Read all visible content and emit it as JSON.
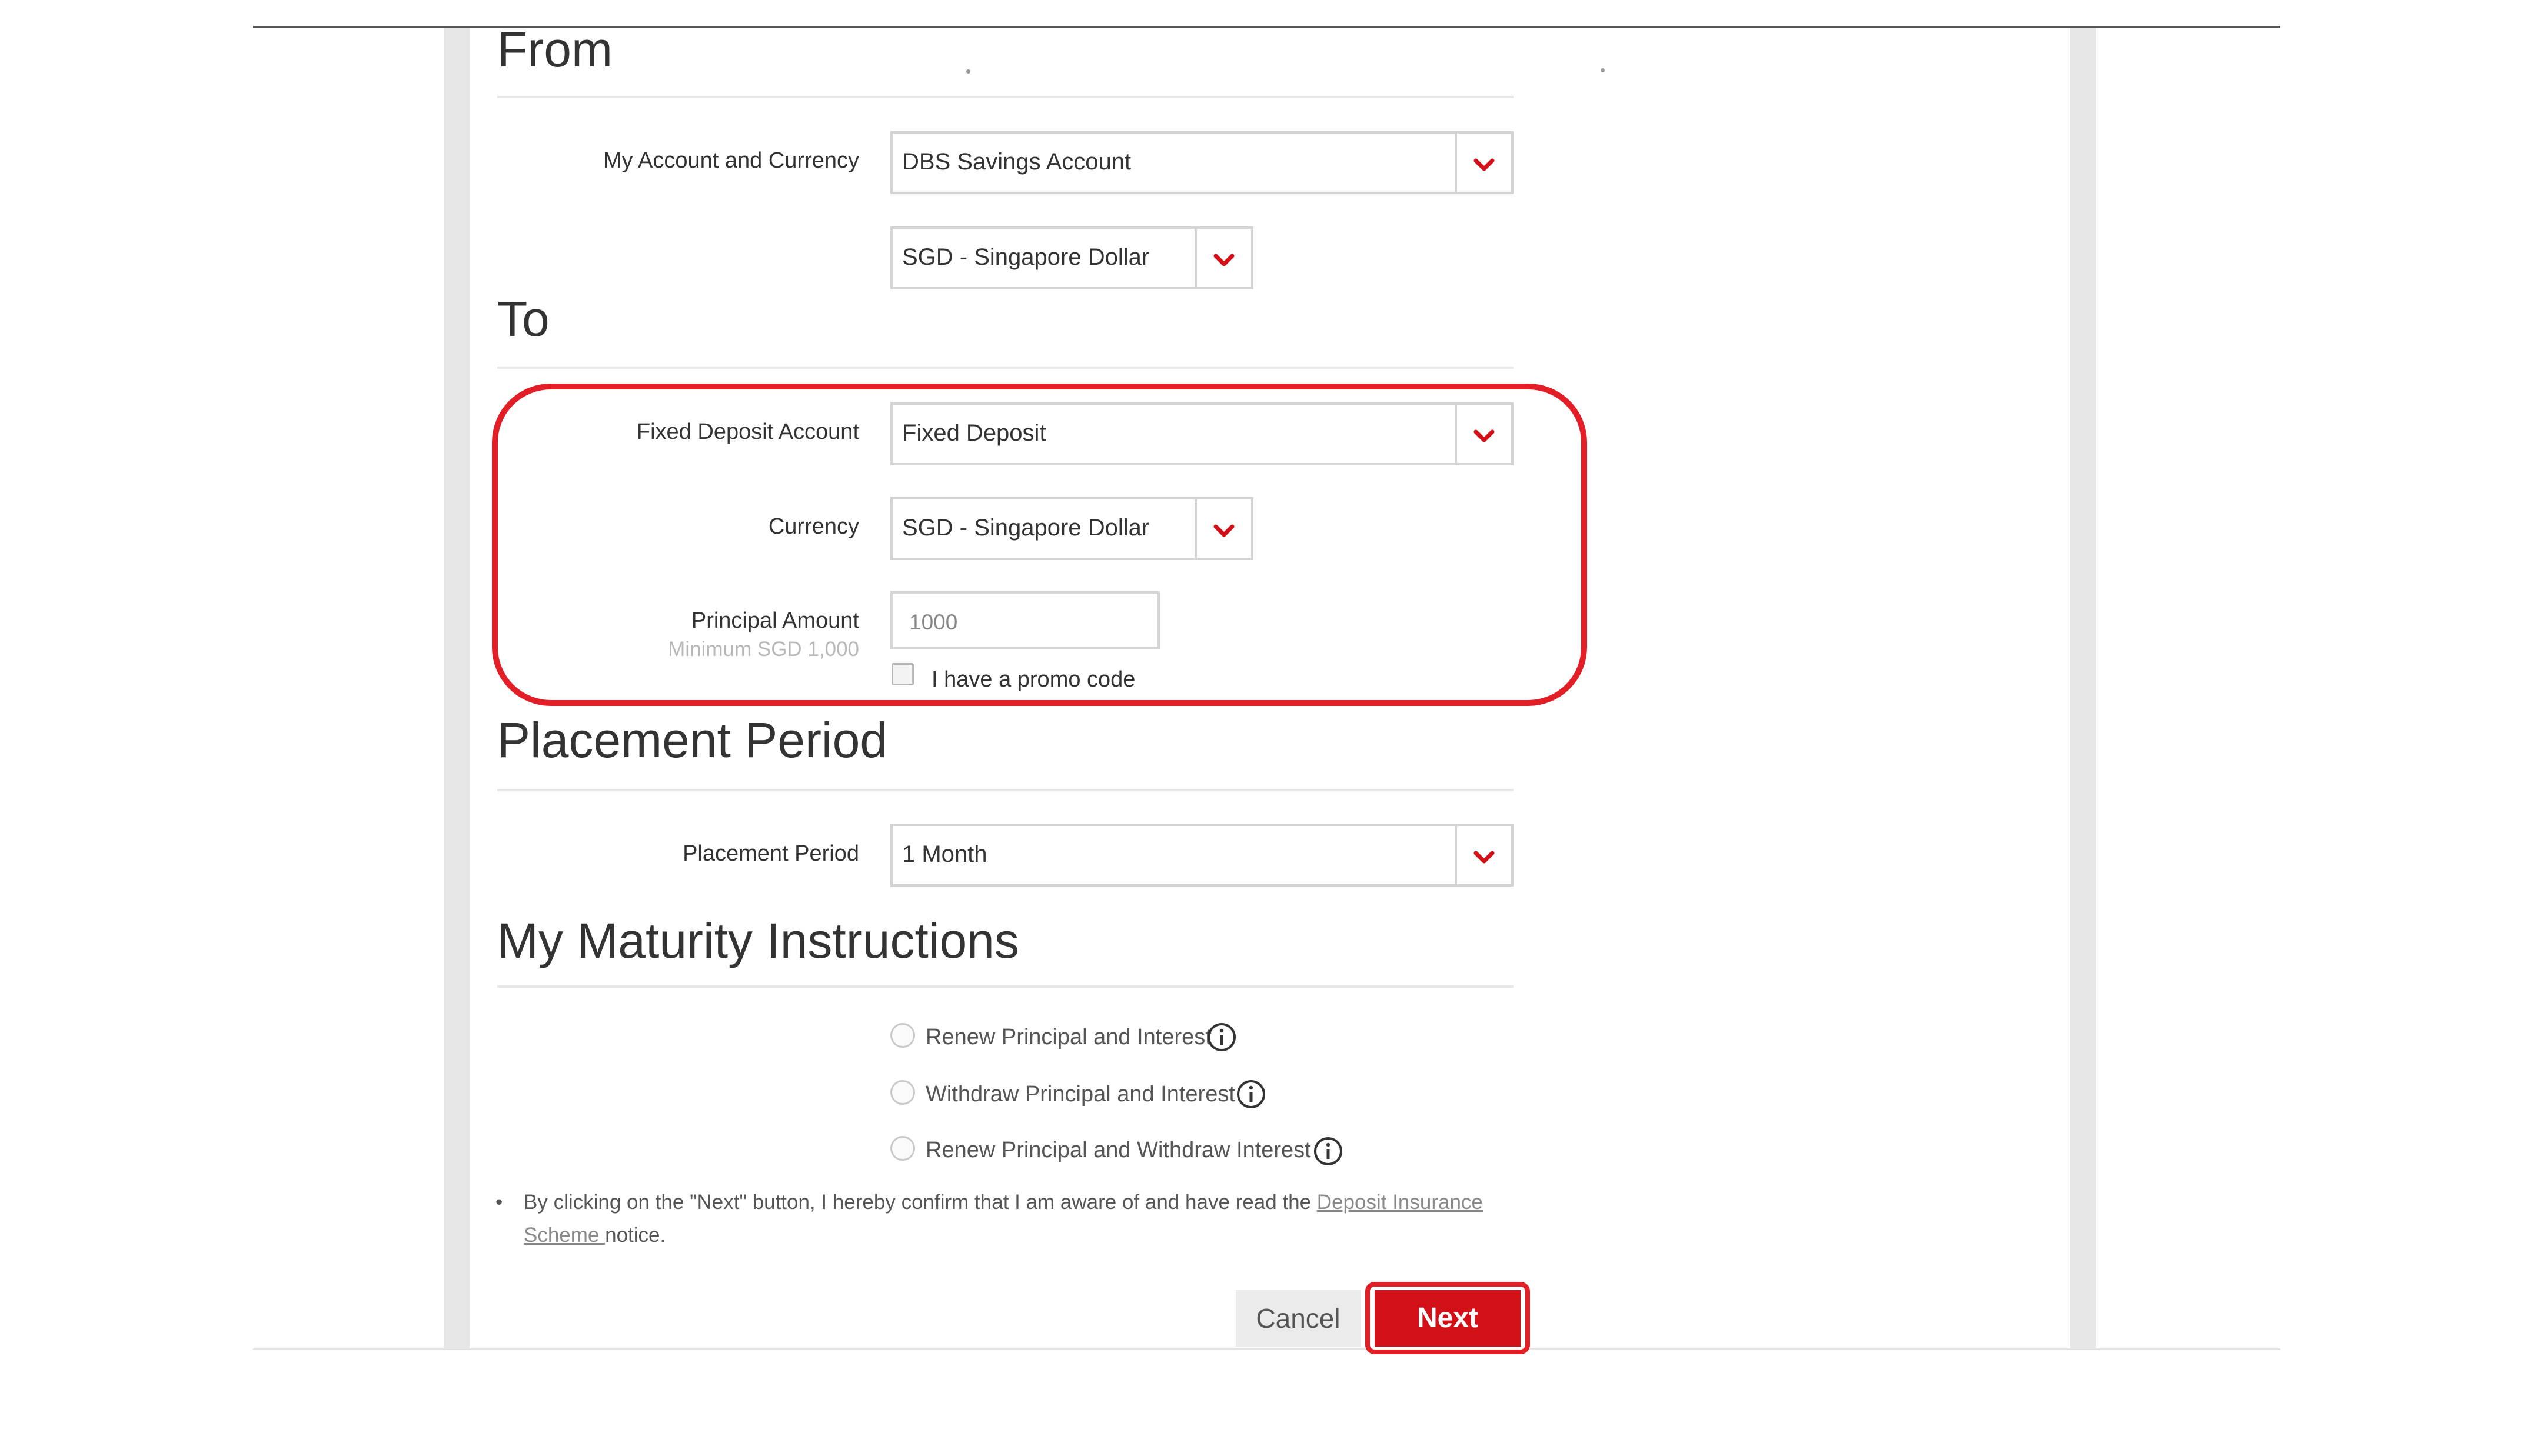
{
  "from": {
    "title": "From",
    "account_label": "My Account and Currency",
    "account_value": "DBS Savings Account",
    "currency_value": "SGD - Singapore Dollar"
  },
  "to": {
    "title": "To",
    "fd_account_label": "Fixed Deposit Account",
    "fd_account_value": "Fixed Deposit",
    "currency_label": "Currency",
    "currency_value": "SGD - Singapore Dollar",
    "principal_label": "Principal Amount",
    "principal_hint": "Minimum SGD 1,000",
    "principal_value": "1000",
    "promo_label": "I have a promo code"
  },
  "placement": {
    "title": "Placement Period",
    "label": "Placement Period",
    "value": "1 Month"
  },
  "maturity": {
    "title": "My Maturity Instructions",
    "options": [
      "Renew Principal and Interest",
      "Withdraw Principal and Interest",
      "Renew Principal and Withdraw Interest"
    ]
  },
  "notice": {
    "bullet": "•",
    "text_before": "By clicking on the \"Next\" button, I hereby confirm that I am aware of and have read the ",
    "link_text": "Deposit Insurance Scheme ",
    "text_after": "notice."
  },
  "buttons": {
    "cancel": "Cancel",
    "next": "Next"
  },
  "colors": {
    "accent_red": "#d31018",
    "highlight_red": "#e21e26"
  },
  "icons": {
    "dropdown": "chevron-down-icon",
    "info": "info-icon"
  }
}
